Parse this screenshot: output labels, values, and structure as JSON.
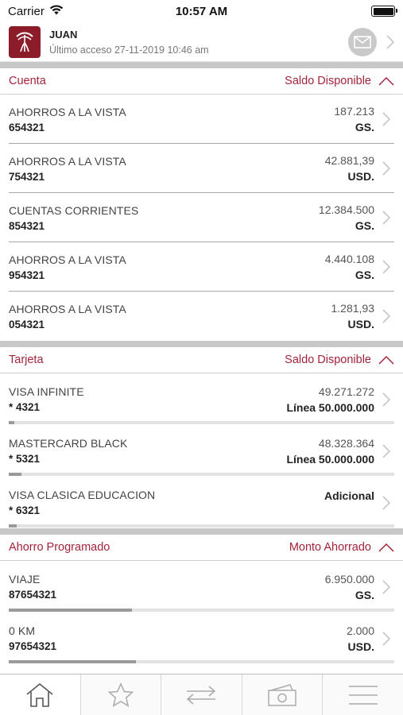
{
  "status": {
    "carrier": "Carrier",
    "time": "10:57 AM"
  },
  "user": {
    "name": "JUAN",
    "last_access": "Último acceso 27-11-2019 10:46 am"
  },
  "accounts_section": {
    "title": "Cuenta",
    "right_label": "Saldo Disponible",
    "items": [
      {
        "name": "AHORROS A LA VISTA",
        "number": "654321",
        "amount": "187.213",
        "currency": "GS."
      },
      {
        "name": "AHORROS A LA VISTA",
        "number": "754321",
        "amount": "42.881,39",
        "currency": "USD."
      },
      {
        "name": "CUENTAS CORRIENTES",
        "number": "854321",
        "amount": "12.384.500",
        "currency": "GS."
      },
      {
        "name": "AHORROS A LA VISTA",
        "number": "954321",
        "amount": "4.440.108",
        "currency": "GS."
      },
      {
        "name": "AHORROS A LA VISTA",
        "number": "054321",
        "amount": "1.281,93",
        "currency": "USD."
      }
    ]
  },
  "cards_section": {
    "title": "Tarjeta",
    "right_label": "Saldo Disponible",
    "items": [
      {
        "name": "VISA INFINITE",
        "number": "* 4321",
        "amount": "49.271.272",
        "detail": "Línea 50.000.000",
        "usage_fraction": 0.015
      },
      {
        "name": "MASTERCARD BLACK",
        "number": "* 5321",
        "amount": "48.328.364",
        "detail": "Línea 50.000.000",
        "usage_fraction": 0.034
      },
      {
        "name": "VISA CLASICA EDUCACION",
        "number": "* 6321",
        "amount": "",
        "detail": "Adicional",
        "usage_fraction": 0.02
      }
    ]
  },
  "savings_section": {
    "title": "Ahorro Programado",
    "right_label": "Monto Ahorrado",
    "items": [
      {
        "name": "VIAJE",
        "number": "87654321",
        "amount": "6.950.000",
        "currency": "GS.",
        "progress_fraction": 0.32
      },
      {
        "name": "0 KM",
        "number": "97654321",
        "amount": "2.000",
        "currency": "USD.",
        "progress_fraction": 0.33
      }
    ]
  },
  "tabbar": {
    "tabs": [
      {
        "icon": "home-icon",
        "active": true
      },
      {
        "icon": "star-icon",
        "active": false
      },
      {
        "icon": "transfer-icon",
        "active": false
      },
      {
        "icon": "cash-icon",
        "active": false
      },
      {
        "icon": "menu-icon",
        "active": false
      }
    ]
  },
  "colors": {
    "accent": "#a3243a",
    "logo_bg": "#8c1c2a"
  }
}
